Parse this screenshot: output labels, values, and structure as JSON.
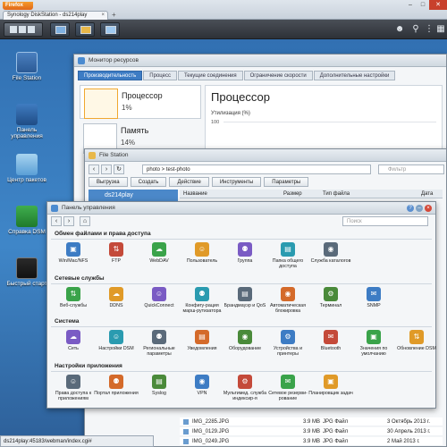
{
  "browser": {
    "menu_label": "Firefox",
    "tab_title": "Synology DiskStation - ds214play",
    "new_tab": "+",
    "tab_close": "×"
  },
  "taskbar": {
    "user_icon": "user-icon",
    "search_icon": "search-icon",
    "options_icon": "options-icon",
    "widgets_icon": "widgets-icon"
  },
  "desktop": {
    "icons": [
      {
        "label": "File Station"
      },
      {
        "label": "Панель управления"
      },
      {
        "label": "Центр пакетов"
      },
      {
        "label": "Справка DSM"
      },
      {
        "label": "Быстрый старт"
      }
    ]
  },
  "resource_monitor": {
    "title": "Монитор ресурсов",
    "tabs": [
      "Производительность",
      "Процесс",
      "Текущие соединения",
      "Ограничение скорости",
      "Дополнительные настройки"
    ],
    "active_tab": 0,
    "items": [
      {
        "name": "Процессор",
        "value": "1%"
      },
      {
        "name": "Память",
        "value": "14%"
      }
    ],
    "main_title": "Процессор",
    "chart_label": "Утилизация (%)",
    "axis_top": "100"
  },
  "file_station": {
    "title": "File Station",
    "path": "photo > test-photo",
    "search_placeholder": "Фильтр",
    "toolbar": [
      "Выгрузка",
      "Создать",
      "Действие",
      "Инструменты",
      "Параметры"
    ],
    "tree_root": "ds214play",
    "columns": [
      "Название",
      "Размер",
      "Тип файла",
      "Дата"
    ],
    "rows": [
      {
        "name": "IMG_2285.JPG",
        "size": "3.9 MB",
        "type": "JPG Файл",
        "date": "3 Октябрь 2013 г."
      },
      {
        "name": "IMG_0129.JPG",
        "size": "3.9 MB",
        "type": "JPG Файл",
        "date": "30 Апрель 2013 г."
      },
      {
        "name": "IMG_0249.JPG",
        "size": "3.9 MB",
        "type": "JPG Файл",
        "date": "2 Май 2013 г."
      }
    ]
  },
  "control_panel": {
    "title": "Панель управления",
    "search_placeholder": "Поиск",
    "sections": [
      {
        "name": "Обмен файлами и права доступа",
        "items": [
          "Win/Mac/NFS",
          "FTP",
          "WebDAV",
          "Пользователь",
          "Группа",
          "Папка общего доступа",
          "Служба каталогов"
        ]
      },
      {
        "name": "Сетевые службы",
        "items": [
          "Веб-службы",
          "DDNS",
          "QuickConnect",
          "Конфигу-рация марш-рутизатора",
          "Брандмауэр и QoS",
          "Автоматическая блокировка",
          "Терминал",
          "SNMP"
        ]
      },
      {
        "name": "Система",
        "items": [
          "Сеть",
          "Настройки DSM",
          "Региональные параметры",
          "Уведомления",
          "Оборудование",
          "Устройства и принтеры",
          "Bluetooth",
          "Значения по умолчанию",
          "Обновление DSM"
        ]
      },
      {
        "name": "Настройки приложения",
        "items": [
          "Права доступа к приложениям",
          "Портал приложения",
          "Syslog",
          "VPN",
          "Мультимед. служба индексир-я",
          "Сетевое резерви-рование",
          "Планировщик задач"
        ]
      }
    ]
  },
  "status_bar": "ds214play:45183/webman/index.cgi#",
  "colors": {
    "accent": "#3d7cc4",
    "desktop": "#3f86c8",
    "close": "#d44a3a"
  }
}
